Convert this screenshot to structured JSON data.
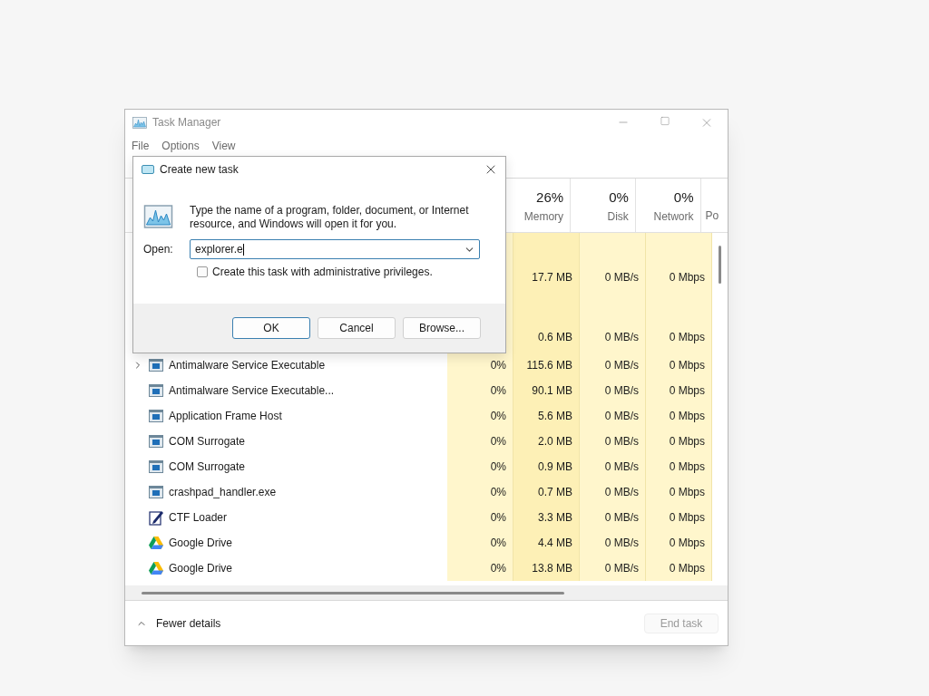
{
  "window": {
    "title": "Task Manager"
  },
  "menu": [
    {
      "label": "File"
    },
    {
      "label": "Options"
    },
    {
      "label": "View"
    }
  ],
  "columns": [
    {
      "percent": "26%",
      "label": "Memory"
    },
    {
      "percent": "0%",
      "label": "Disk"
    },
    {
      "percent": "0%",
      "label": "Network"
    },
    {
      "label": "Po"
    }
  ],
  "rows": [
    {
      "kind": "group"
    },
    {
      "kind": "hidden",
      "memory": "17.7 MB",
      "disk": "0 MB/s",
      "network": "0 Mbps"
    },
    {
      "kind": "group"
    },
    {
      "kind": "hidden",
      "memory": "0.6 MB",
      "disk": "0 MB/s",
      "network": "0 Mbps"
    },
    {
      "kind": "app-group",
      "expanded": false,
      "name": "Antimalware Service Executable",
      "cpu": "0%",
      "memory": "115.6 MB",
      "disk": "0 MB/s",
      "network": "0 Mbps"
    },
    {
      "kind": "app",
      "name": "Antimalware Service Executable...",
      "cpu": "0%",
      "memory": "90.1 MB",
      "disk": "0 MB/s",
      "network": "0 Mbps"
    },
    {
      "kind": "app",
      "name": "Application Frame Host",
      "cpu": "0%",
      "memory": "5.6 MB",
      "disk": "0 MB/s",
      "network": "0 Mbps"
    },
    {
      "kind": "app",
      "name": "COM Surrogate",
      "cpu": "0%",
      "memory": "2.0 MB",
      "disk": "0 MB/s",
      "network": "0 Mbps"
    },
    {
      "kind": "app",
      "name": "COM Surrogate",
      "cpu": "0%",
      "memory": "0.9 MB",
      "disk": "0 MB/s",
      "network": "0 Mbps"
    },
    {
      "kind": "app",
      "name": "crashpad_handler.exe",
      "cpu": "0%",
      "memory": "0.7 MB",
      "disk": "0 MB/s",
      "network": "0 Mbps"
    },
    {
      "kind": "editor",
      "name": "CTF Loader",
      "cpu": "0%",
      "memory": "3.3 MB",
      "disk": "0 MB/s",
      "network": "0 Mbps"
    },
    {
      "kind": "drive",
      "name": "Google Drive",
      "cpu": "0%",
      "memory": "4.4 MB",
      "disk": "0 MB/s",
      "network": "0 Mbps"
    },
    {
      "kind": "drive",
      "name": "Google Drive",
      "cpu": "0%",
      "memory": "13.8 MB",
      "disk": "0 MB/s",
      "network": "0 Mbps"
    }
  ],
  "footer": {
    "details": "Fewer details",
    "end_task": {
      "label": "End task",
      "disabled": true
    }
  },
  "dialog": {
    "title": "Create new task",
    "description": "Type the name of a program, folder, document, or Internet resource, and Windows will open it for you.",
    "open_label": "Open:",
    "value": "explorer.e",
    "admin": {
      "label": "Create this task with administrative privileges.",
      "checked": false
    },
    "buttons": [
      {
        "label": "OK",
        "default": true
      },
      {
        "label": "Cancel",
        "default": false
      },
      {
        "label": "Browse...",
        "default": false
      }
    ]
  }
}
